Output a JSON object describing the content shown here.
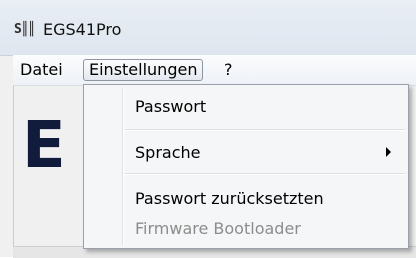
{
  "window": {
    "app_icon_text": "S║║",
    "title": "EGS41Pro"
  },
  "menubar": {
    "items": [
      {
        "label": "Datei"
      },
      {
        "label": "Einstellungen"
      },
      {
        "label": "?"
      }
    ]
  },
  "main": {
    "big_letter": "E"
  },
  "dropdown": {
    "items": [
      {
        "label": "Passwort"
      },
      {
        "label": "Sprache"
      },
      {
        "label": "Passwort zurücksetzten"
      },
      {
        "label": "Firmware Bootloader"
      }
    ],
    "submenu_arrow_icon": "triangle-right-icon"
  }
}
